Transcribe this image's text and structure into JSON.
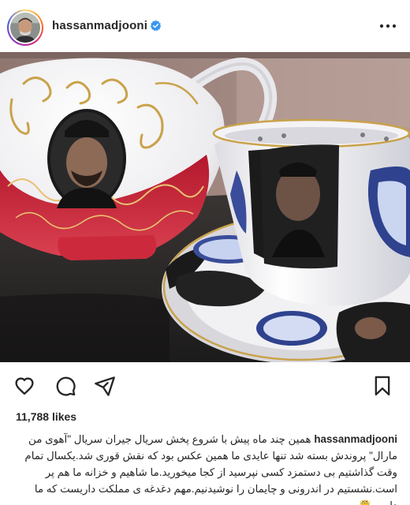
{
  "post": {
    "username": "hassanmadjooni",
    "verified": true,
    "avatar_icon": "profile-photo",
    "more_icon": "more-horizontal-icon",
    "image_description_icon": "teapot-teacup-photo"
  },
  "actions": {
    "like_icon": "heart-icon",
    "comment_icon": "comment-icon",
    "share_icon": "share-icon",
    "save_icon": "bookmark-icon"
  },
  "likes": {
    "text": "11,788 likes"
  },
  "caption": {
    "username": "hassanmadjooni",
    "text": "همین چند ماه پیش با شروع پخش سریال جیران سریال \"آهوی من مارال\" پروندش بسته شد تنها عایدی ما همین عکس بود که نقش قوری شد.یکسال تمام وقت گذاشتیم بی دستمزد کسی نپرسید از کجا میخورید.ما شاهیم و خزانه ما هم پر است.نشستیم در اندرونی و چایمان را نوشیدنیم.مهم دغدغه ی مملکت داریست که ما داریم 🤴"
  },
  "colors": {
    "text": "#262626",
    "verified": "#3897f0",
    "teapot_red": "#c8283a",
    "gold": "#c9a24a"
  }
}
